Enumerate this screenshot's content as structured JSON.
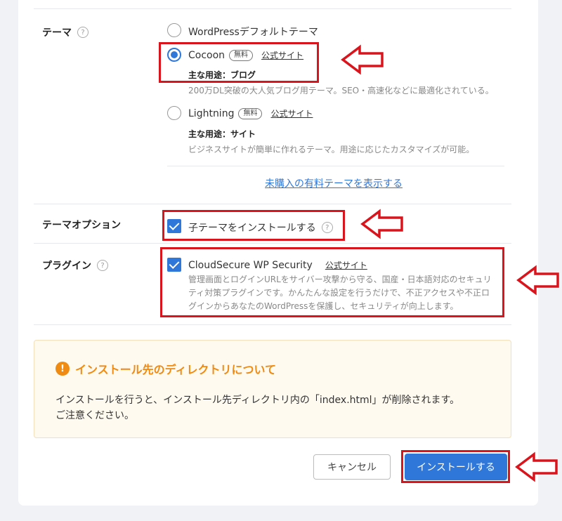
{
  "theme_section": {
    "label": "テーマ",
    "help": "?",
    "options": [
      {
        "name": "WordPressデフォルトテーマ",
        "checked": false
      },
      {
        "name": "Cocoon",
        "badge": "無料",
        "link": "公式サイト",
        "use": "主な用途：ブログ",
        "desc": "200万DL突破の大人気ブログ用テーマ。SEO・高速化などに最適化されている。",
        "checked": true
      },
      {
        "name": "Lightning",
        "badge": "無料",
        "link": "公式サイト",
        "use": "主な用途：サイト",
        "desc": "ビジネスサイトが簡単に作れるテーマ。用途に応じたカスタマイズが可能。",
        "checked": false
      }
    ],
    "show_paid_link": "未購入の有料テーマを表示する"
  },
  "theme_option": {
    "label": "テーマオプション",
    "checkbox_label": "子テーマをインストールする",
    "help": "?",
    "checked": true
  },
  "plugin": {
    "label": "プラグイン",
    "help": "?",
    "name": "CloudSecure WP Security",
    "link": "公式サイト",
    "desc_lines": [
      "管理画面とログインURLをサイバー攻撃から守る、国産・日本語対応のセキュリ",
      "ティ対策プラグインです。かんたんな設定を行うだけで、不正アクセスや不正ロ",
      "グインからあなたのWordPressを保護し、セキュリティが向上します。"
    ],
    "checked": true
  },
  "notice": {
    "icon": "!",
    "title": "インストール先のディレクトリについて",
    "body_line1": "インストールを行うと、インストール先ディレクトリ内の「index.html」が削除されます。",
    "body_line2": "ご注意ください。"
  },
  "buttons": {
    "cancel": "キャンセル",
    "install": "インストールする"
  },
  "colors": {
    "accent": "#2f77d9",
    "highlight": "#d9141c",
    "warning": "#ef8a12"
  }
}
